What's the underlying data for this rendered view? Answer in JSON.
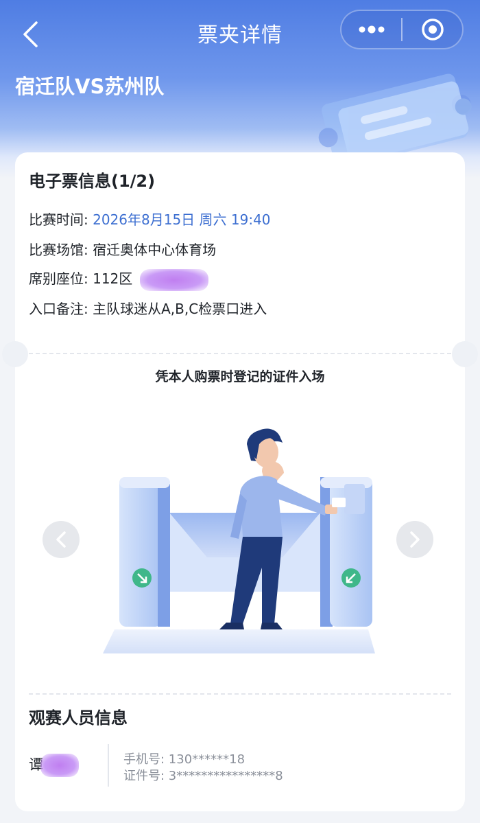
{
  "nav": {
    "title": "票夹详情"
  },
  "event": {
    "title": "宿迁队VS苏州队"
  },
  "ticket_info": {
    "title": "电子票信息(1/2)",
    "match_time_label": "比赛时间: ",
    "match_time_value": "2026年8月15日 周六 19:40",
    "venue_label": "比赛场馆: ",
    "venue_value": "宿迁奥体中心体育场",
    "seat_label": "席别座位: ",
    "seat_value": "112区",
    "entrance_label": "入口备注: ",
    "entrance_value": "主队球迷从A,B,C检票口进入"
  },
  "entry_hint": "凭本人购票时登记的证件入场",
  "viewer": {
    "title": "观赛人员信息",
    "name": "谭",
    "phone_label": "手机号: ",
    "phone_value": "130******18",
    "id_label": "证件号: ",
    "id_value": "3****************8"
  },
  "colors": {
    "header_blue": "#4f7de3",
    "link_blue": "#3d6fd1",
    "gate_green": "#3fb78a",
    "redaction_purple": "#c07ff0"
  },
  "icons": {
    "back": "chevron-left-icon",
    "more": "more-dots-icon",
    "close": "target-circle-icon",
    "prev": "chevron-left-icon",
    "next": "chevron-right-icon"
  }
}
